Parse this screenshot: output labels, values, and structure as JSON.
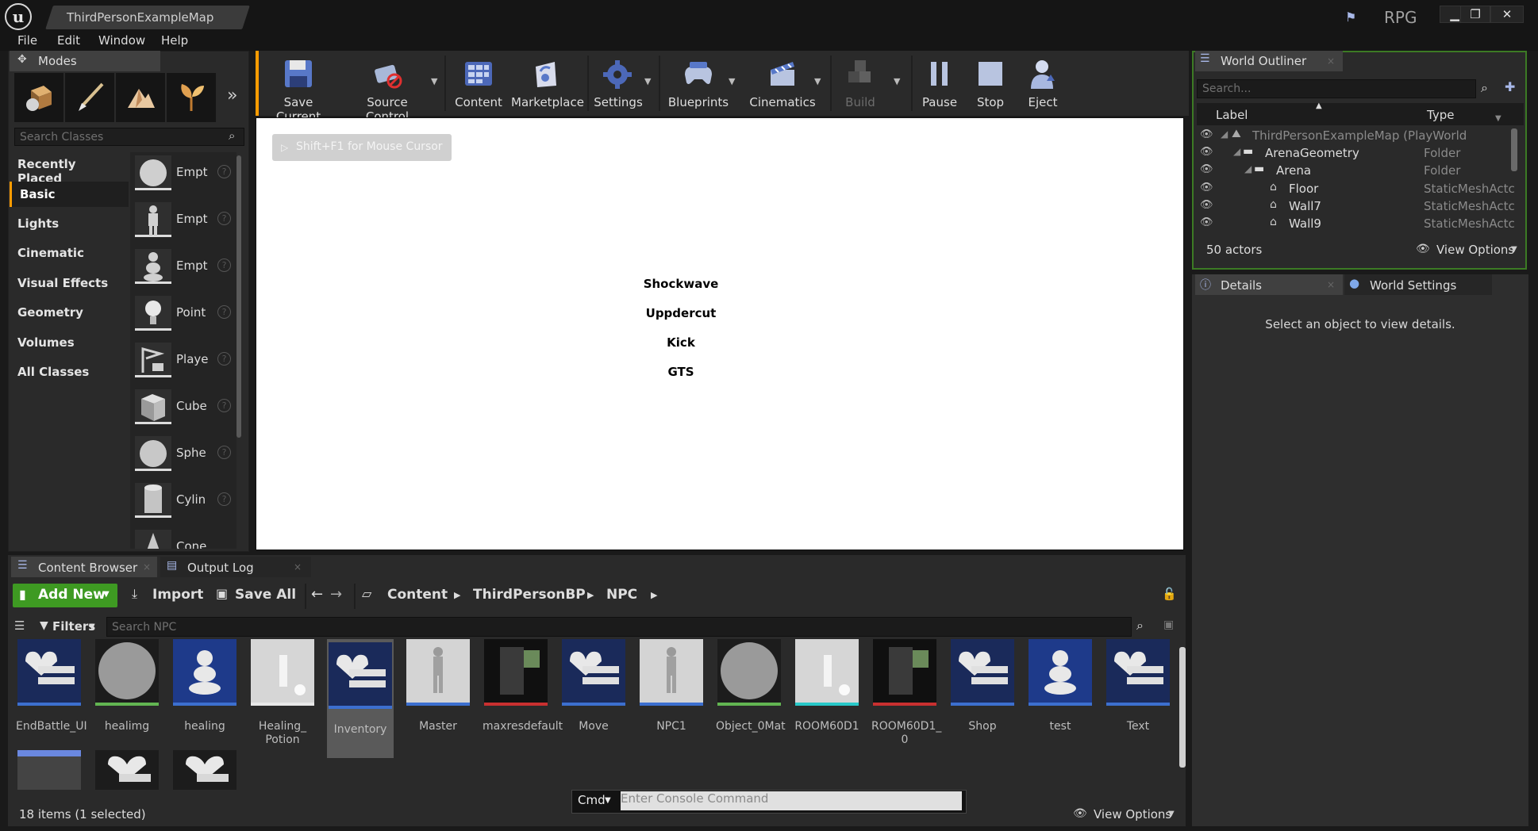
{
  "window": {
    "doc_tab": "ThirdPersonExampleMap",
    "project": "RPG",
    "minimize": "▁",
    "restore": "❐",
    "close": "✕"
  },
  "menu": [
    "File",
    "Edit",
    "Window",
    "Help"
  ],
  "modes": {
    "tab": "Modes",
    "search_placeholder": "Search Classes",
    "categories": [
      "Recently Placed",
      "Basic",
      "Lights",
      "Cinematic",
      "Visual Effects",
      "Geometry",
      "Volumes",
      "All Classes"
    ],
    "selected_category": "Basic",
    "assets": [
      "Empt",
      "Empt",
      "Empt",
      "Point",
      "Playe",
      "Cube",
      "Sphe",
      "Cylin",
      "Cone"
    ]
  },
  "toolbar": {
    "save_current": "Save Current",
    "source_control": "Source Control",
    "content": "Content",
    "marketplace": "Marketplace",
    "settings": "Settings",
    "blueprints": "Blueprints",
    "cinematics": "Cinematics",
    "build": "Build",
    "pause": "Pause",
    "stop": "Stop",
    "eject": "Eject"
  },
  "viewport": {
    "hint": "Shift+F1 for Mouse Cursor",
    "items": [
      "Shockwave",
      "Uppdercut",
      "Kick",
      "GTS"
    ]
  },
  "outliner": {
    "tab": "World Outliner",
    "search_placeholder": "Search...",
    "col_label": "Label",
    "col_type": "Type",
    "rows": [
      {
        "label": "ThirdPersonExampleMap (PlayWorld",
        "type": ""
      },
      {
        "label": "ArenaGeometry",
        "type": "Folder"
      },
      {
        "label": "Arena",
        "type": "Folder"
      },
      {
        "label": "Floor",
        "type": "StaticMeshActc"
      },
      {
        "label": "Wall7",
        "type": "StaticMeshActc"
      },
      {
        "label": "Wall9",
        "type": "StaticMeshActc"
      }
    ],
    "actor_count": "50 actors",
    "view_options": "View Options"
  },
  "details": {
    "tab_details": "Details",
    "tab_world_settings": "World Settings",
    "empty_message": "Select an object to view details."
  },
  "content_browser": {
    "tab": "Content Browser",
    "tab_output": "Output Log",
    "add_new": "Add New",
    "import": "Import",
    "save_all": "Save All",
    "breadcrumb": [
      "Content",
      "ThirdPersonBP",
      "NPC"
    ],
    "filters": "Filters",
    "search_placeholder": "Search NPC",
    "assets": [
      {
        "name": "EndBattle_UI",
        "kind": "widget",
        "color": "#3c6fcf"
      },
      {
        "name": "healimg",
        "kind": "material",
        "color": "#62b552"
      },
      {
        "name": "healing",
        "kind": "mesh",
        "color": "#3c6fcf"
      },
      {
        "name": "Healing_\nPotion",
        "kind": "level",
        "color": "#e8e8e8"
      },
      {
        "name": "Inventory",
        "kind": "widget",
        "color": "#3c6fcf"
      },
      {
        "name": "Master",
        "kind": "skeletal",
        "color": "#3c6fcf"
      },
      {
        "name": "maxresdefault",
        "kind": "texture",
        "color": "#c83030"
      },
      {
        "name": "Move",
        "kind": "widget",
        "color": "#3c6fcf"
      },
      {
        "name": "NPC1",
        "kind": "skeletal",
        "color": "#3c6fcf"
      },
      {
        "name": "Object_0Mat",
        "kind": "material",
        "color": "#62b552"
      },
      {
        "name": "ROOM60D1",
        "kind": "level",
        "color": "#28c8c8"
      },
      {
        "name": "ROOM60D1_\n0",
        "kind": "texture",
        "color": "#c83030"
      },
      {
        "name": "Shop",
        "kind": "widget",
        "color": "#3c6fcf"
      },
      {
        "name": "test",
        "kind": "mesh",
        "color": "#3c6fcf"
      },
      {
        "name": "Text",
        "kind": "widget",
        "color": "#3c6fcf"
      }
    ],
    "item_count": "18 items (1 selected)",
    "view_options": "View Options"
  },
  "console": {
    "cmd": "Cmd",
    "placeholder": "Enter Console Command"
  }
}
